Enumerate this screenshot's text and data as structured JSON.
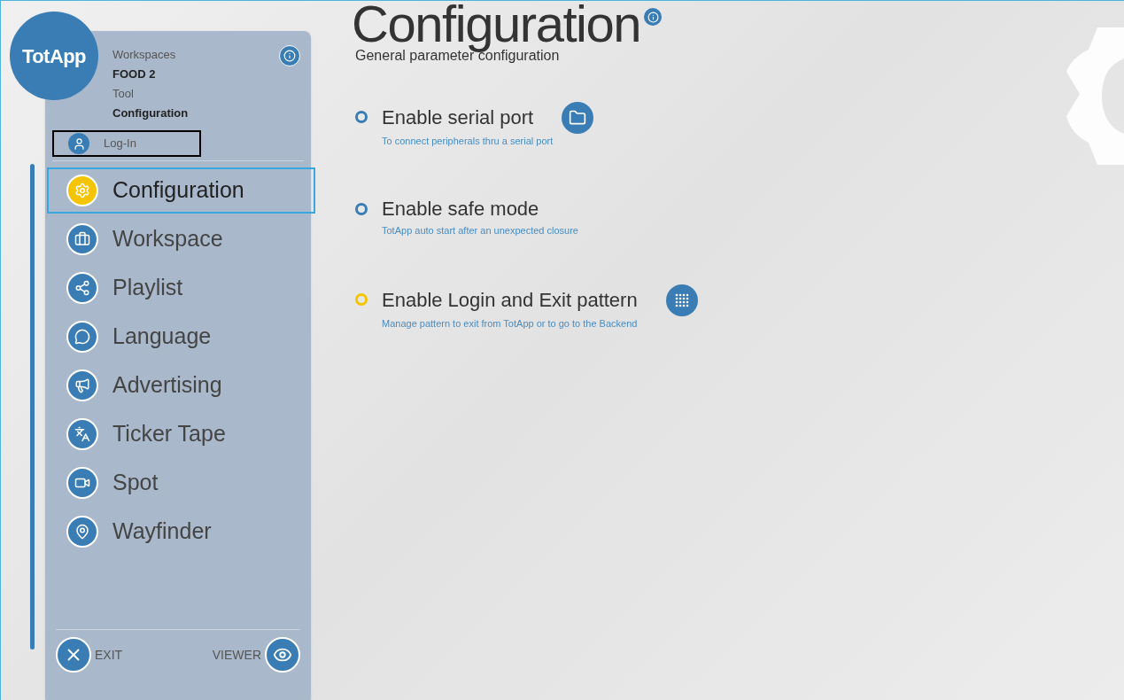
{
  "logo": {
    "text": "TotApp"
  },
  "header": {
    "lines": [
      {
        "text": "Workspaces",
        "bold": false
      },
      {
        "text": "FOOD 2",
        "bold": true
      },
      {
        "text": "Tool",
        "bold": false
      },
      {
        "text": "Configuration",
        "bold": true
      }
    ]
  },
  "login": {
    "label": "Log-In"
  },
  "nav": [
    {
      "label": "Configuration",
      "selected": true
    },
    {
      "label": "Workspace",
      "selected": false
    },
    {
      "label": "Playlist",
      "selected": false
    },
    {
      "label": "Language",
      "selected": false
    },
    {
      "label": "Advertising",
      "selected": false
    },
    {
      "label": "Ticker Tape",
      "selected": false
    },
    {
      "label": "Spot",
      "selected": false
    },
    {
      "label": "Wayfinder",
      "selected": false
    }
  ],
  "footer": {
    "exit": "EXIT",
    "viewer": "VIEWER"
  },
  "page": {
    "title": "Configuration",
    "subtitle": "General parameter configuration"
  },
  "options": [
    {
      "title": "Enable serial port",
      "description": "To connect peripherals thru a serial port",
      "selected": false,
      "kind": "folder"
    },
    {
      "title": "Enable safe mode",
      "description": "TotApp auto start after an unexpected closure",
      "selected": false,
      "kind": "plain"
    },
    {
      "title": "Enable Login and Exit pattern",
      "description": "Manage pattern to exit from TotApp or to go to the Backend",
      "selected": true,
      "kind": "grid"
    }
  ]
}
